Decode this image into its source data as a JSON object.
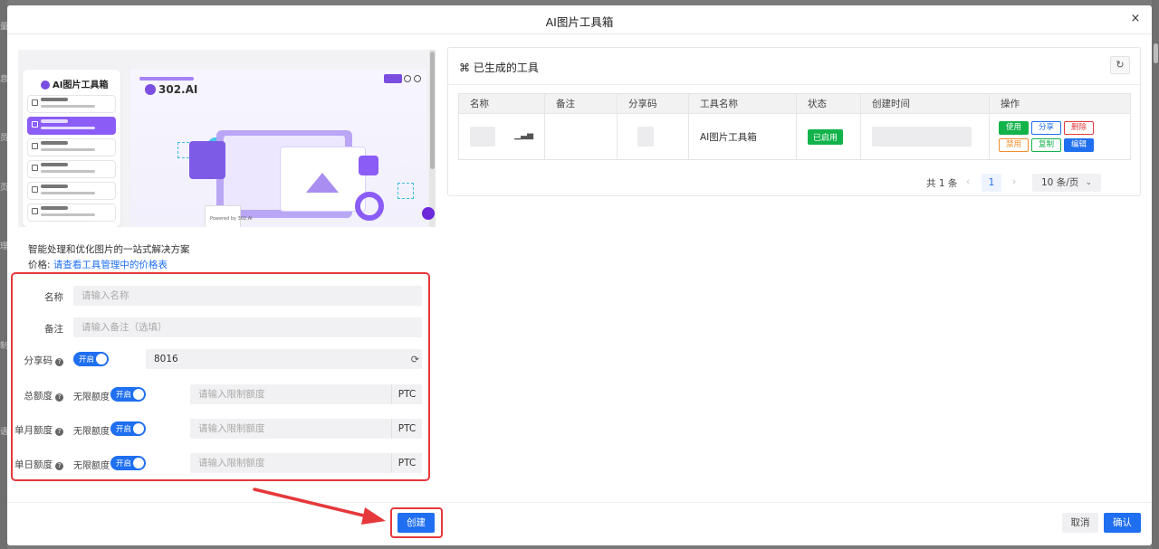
{
  "modal": {
    "title": "AI图片工具箱",
    "close_glyph": "×"
  },
  "preview": {
    "sidebar_logo": "AI图片工具箱",
    "brand": "302.AI",
    "powered": "Powered by 302.AI"
  },
  "tool": {
    "description": "智能处理和优化图片的一站式解决方案",
    "price_label": "价格:",
    "price_link": "请查看工具管理中的价格表"
  },
  "form": {
    "name_label": "名称",
    "name_placeholder": "请输入名称",
    "note_label": "备注",
    "note_placeholder": "请输入备注（选填）",
    "share_label": "分享码",
    "share_toggle": "开启",
    "share_code": "8016",
    "total_label": "总额度",
    "monthly_label": "单月额度",
    "daily_label": "单日额度",
    "unlimited_label": "无限额度",
    "quota_toggle": "开启",
    "quota_placeholder": "请输入限制额度",
    "unit": "PTC",
    "help_glyph": "?"
  },
  "tools_panel": {
    "title": "⌘ 已生成的工具",
    "refresh_glyph": "↻",
    "columns": [
      "名称",
      "备注",
      "分享码",
      "工具名称",
      "状态",
      "创建时间",
      "操作"
    ],
    "row": {
      "tool_name": "AI图片工具箱",
      "status": "已启用",
      "actions": [
        "使用",
        "分享",
        "删除",
        "禁用",
        "复制",
        "编辑"
      ]
    },
    "pagination": {
      "total": "共 1 条",
      "prev": "‹",
      "page": "1",
      "next": "›",
      "page_size": "10 条/页",
      "chevron": "⌄"
    }
  },
  "footer": {
    "create": "创建",
    "cancel": "取消",
    "confirm": "确认"
  },
  "colors": {
    "primary": "#1f6ff0",
    "success": "#12b34a",
    "danger": "#e5383b",
    "warning": "#f08c2a"
  }
}
